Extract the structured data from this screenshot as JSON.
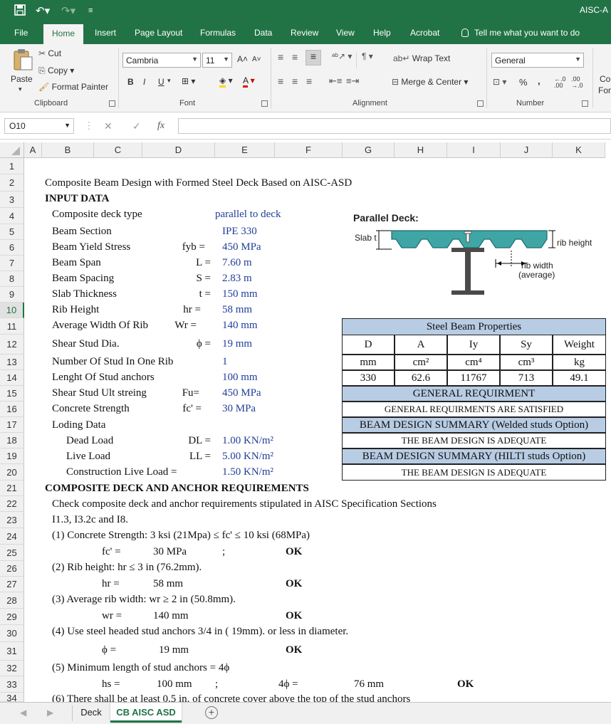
{
  "app": {
    "title": "AISC-A"
  },
  "ribbon_tabs": [
    "File",
    "Home",
    "Insert",
    "Page Layout",
    "Formulas",
    "Data",
    "Review",
    "View",
    "Help",
    "Acrobat"
  ],
  "tell_me": "Tell me what you want to do",
  "clipboard": {
    "paste": "Paste",
    "cut": "Cut",
    "copy": "Copy",
    "format_painter": "Format Painter",
    "label": "Clipboard"
  },
  "font": {
    "name": "Cambria",
    "size": "11",
    "label": "Font",
    "bold": "B",
    "italic": "I",
    "underline": "U"
  },
  "alignment": {
    "wrap": "Wrap Text",
    "merge": "Merge & Center",
    "label": "Alignment"
  },
  "number": {
    "format": "General",
    "label": "Number",
    "percent": "%",
    "comma": ","
  },
  "styles_cut": {
    "line1": "Co",
    "line2": "For"
  },
  "name_box": "O10",
  "columns": [
    "A",
    "B",
    "C",
    "D",
    "E",
    "F",
    "G",
    "H",
    "I",
    "J",
    "K"
  ],
  "rows": [
    "1",
    "2",
    "3",
    "4",
    "5",
    "6",
    "7",
    "8",
    "9",
    "10",
    "11",
    "12",
    "13",
    "14",
    "15",
    "16",
    "17",
    "18",
    "19",
    "20",
    "21",
    "22",
    "23",
    "24",
    "25",
    "26",
    "27",
    "28",
    "29",
    "30",
    "31",
    "32",
    "33",
    "34"
  ],
  "sheet": {
    "title": "Composite Beam Design with Formed Steel Deck Based on AISC-ASD",
    "input_header": "INPUT DATA",
    "inputs": [
      {
        "label": "Composite deck type",
        "sym": "",
        "value": "parallel to deck"
      },
      {
        "label": "Beam Section",
        "sym": "",
        "value": "IPE 330"
      },
      {
        "label": "Beam Yield Stress",
        "sym": "fyb =",
        "value": "450 MPa"
      },
      {
        "label": "Beam Span",
        "sym": "L =",
        "value": "7.60 m"
      },
      {
        "label": "Beam Spacing",
        "sym": "S =",
        "value": "2.83 m"
      },
      {
        "label": "Slab Thickness",
        "sym": "t =",
        "value": "150 mm"
      },
      {
        "label": "Rib Height",
        "sym": "hr =",
        "value": "58 mm"
      },
      {
        "label": "Average Width Of Rib",
        "sym": "Wr =",
        "value": "140 mm"
      },
      {
        "label": "Shear Stud Dia.",
        "sym": "ϕ =",
        "value": "19 mm"
      },
      {
        "label": "Number Of Stud In One Rib",
        "sym": "",
        "value": "1"
      },
      {
        "label": "Lenght Of Stud anchors",
        "sym": "",
        "value": "100 mm"
      },
      {
        "label": "Shear Stud Ult streing",
        "sym": "Fu=",
        "value": "450 MPa"
      },
      {
        "label": "Concrete Strength",
        "sym": "fc' =",
        "value": "30 MPa"
      }
    ],
    "loading_header": "Loding Data",
    "loads": [
      {
        "label": "Dead Load",
        "sym": "DL =",
        "value": "1.00 KN/m²"
      },
      {
        "label": "Live Load",
        "sym": "LL =",
        "value": "5.00 KN/m²"
      },
      {
        "label": "Construction Live Load =",
        "sym": "",
        "value": "1.50 KN/m²"
      }
    ],
    "deck_header": "COMPOSITE DECK AND ANCHOR REQUIREMENTS",
    "check_line1": "Check composite deck and anchor requirements stipulated in AISC Specification Sections",
    "check_line2": "I1.3, I3.2c and I8.",
    "req1": "(1) Concrete Strength: 3 ksi (21Mpa) ≤ fc' ≤ 10 ksi (68MPa)",
    "req1_sym": "fc' =",
    "req1_val": "30 MPa",
    "req1_semi": ";",
    "req1_ok": "OK",
    "req2": "(2) Rib height: hr ≤ 3 in (76.2mm).",
    "req2_sym": "hr =",
    "req2_val": "58 mm",
    "req2_ok": "OK",
    "req3": "(3) Average rib width: wr ≥ 2 in (50.8mm).",
    "req3_sym": "wr =",
    "req3_val": "140 mm",
    "req3_ok": "OK",
    "req4": "(4) Use steel headed stud anchors 3/4 in ( 19mm). or less in diameter.",
    "req4_sym": "ϕ =",
    "req4_val": "19 mm",
    "req4_ok": "OK",
    "req5": "(5) Minimum length of stud anchors = 4ϕ",
    "req5_sym": "hs =",
    "req5_val": "100 mm",
    "req5_semi": ";",
    "req5_sym2": "4ϕ =",
    "req5_val2": "76 mm",
    "req5_ok": "OK",
    "req6": "(6) There shall be at least 0.5 in. of concrete cover above the top of the  stud anchors"
  },
  "diagram": {
    "title": "Parallel Deck:",
    "slab_label": "Slab t",
    "rib_height": "rib height",
    "rib_width": "rib width",
    "rib_width2": "(average)"
  },
  "properties": {
    "title": "Steel Beam Properties",
    "headers": [
      "D",
      "A",
      "Iy",
      "Sy",
      "Weight"
    ],
    "units": [
      "mm",
      "cm²",
      "cm⁴",
      "cm³",
      "kg"
    ],
    "values": [
      "330",
      "62.6",
      "11767",
      "713",
      "49.1"
    ],
    "general_title": "GENERAL REQUIRMENT",
    "general_text": "GENERAL REQUIRMENTS ARE SATISFIED",
    "welded_title": "BEAM DESIGN SUMMARY (Welded studs Option)",
    "welded_text": "THE BEAM DESIGN IS ADEQUATE",
    "hilti_title": "BEAM DESIGN SUMMARY (HILTI studs Option)",
    "hilti_text": "THE BEAM DESIGN IS ADEQUATE"
  },
  "sheet_tabs": [
    "Deck",
    "CB AISC ASD"
  ],
  "colors": {
    "excel_green": "#217346",
    "header_blue": "#b8cce4",
    "value_blue": "#1f3f99"
  }
}
